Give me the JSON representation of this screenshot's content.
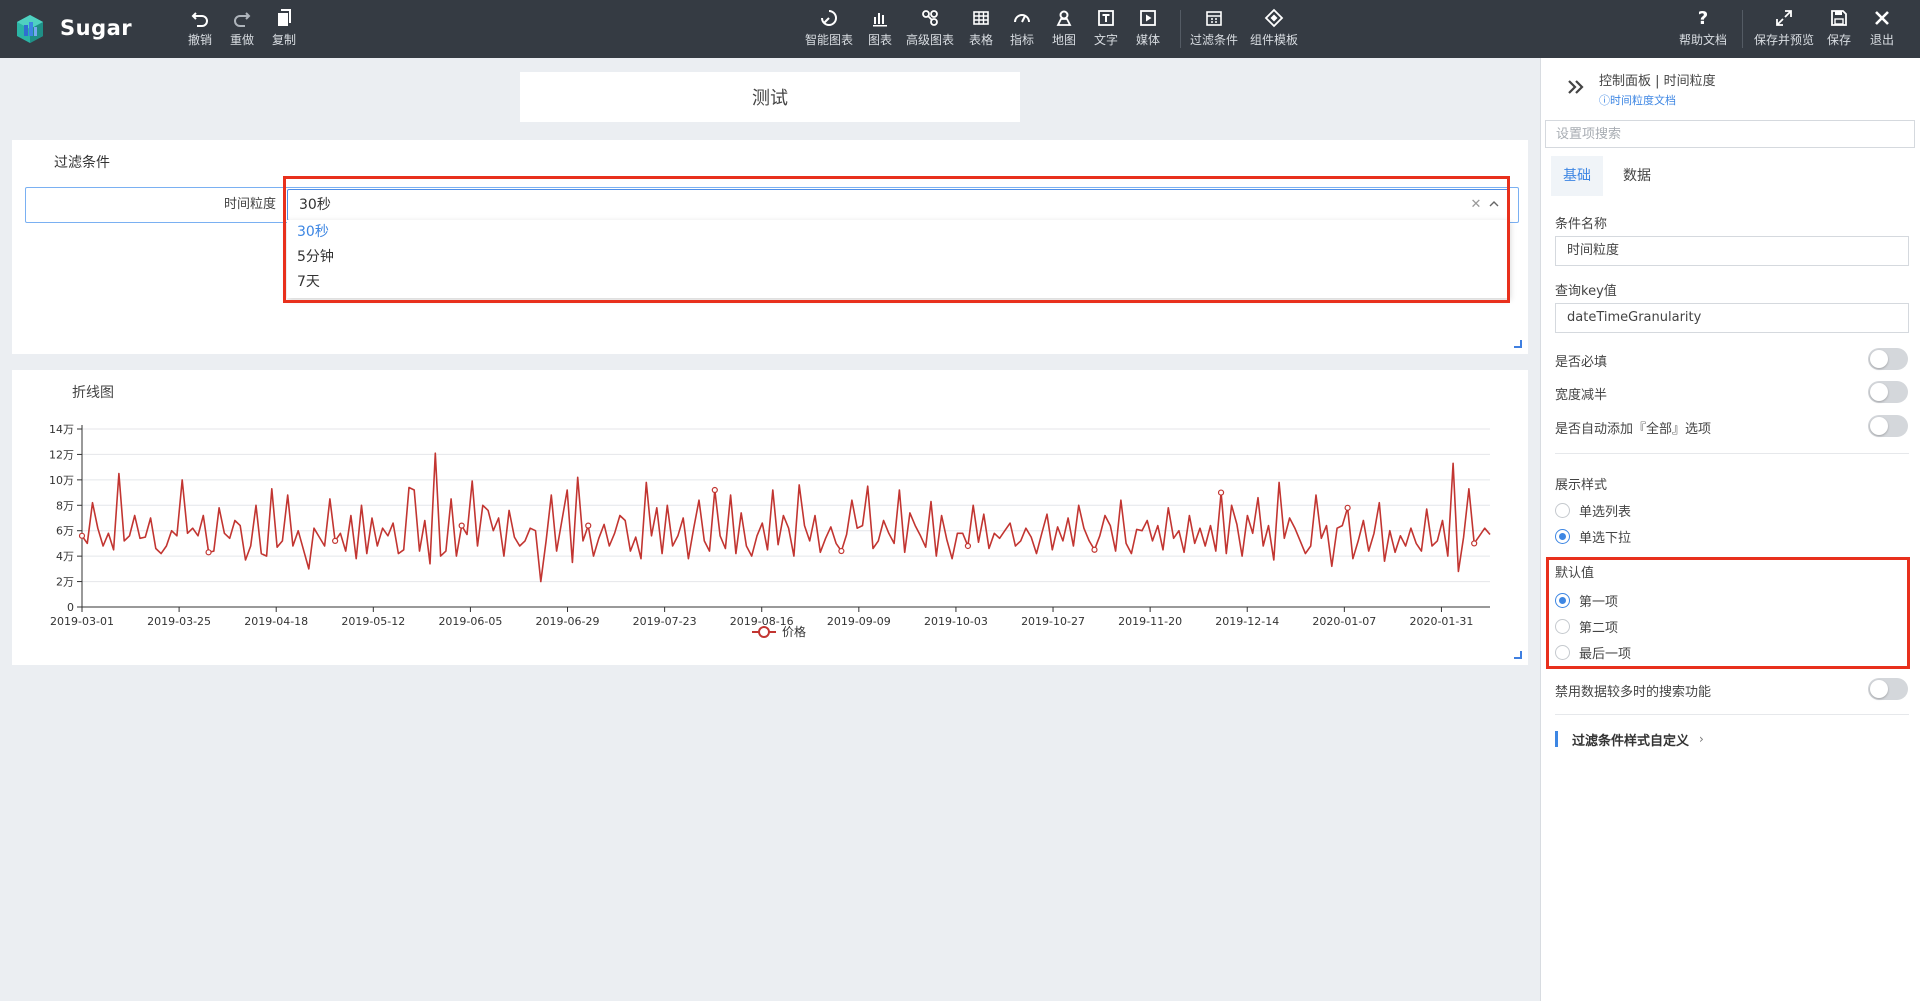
{
  "app": {
    "brand": "Sugar",
    "colors": {
      "topbar": "#353b43",
      "accent": "#3d86e3",
      "series": "#c23531",
      "highlight": "#e8301c"
    }
  },
  "toolbar": {
    "undo": "撤销",
    "redo": "重做",
    "copy": "复制",
    "smart_chart": "智能图表",
    "chart": "图表",
    "advanced_chart": "高级图表",
    "table": "表格",
    "metric": "指标",
    "map": "地图",
    "text": "文字",
    "media": "媒体",
    "filter": "过滤条件",
    "template": "组件模板",
    "help": "帮助文档",
    "save_preview": "保存并预览",
    "save": "保存",
    "exit": "退出"
  },
  "page": {
    "title": "测试"
  },
  "filter_card": {
    "title": "过滤条件",
    "label": "时间粒度",
    "selected": "30秒",
    "options": [
      "30秒",
      "5分钟",
      "7天"
    ],
    "clear_icon": "close-icon",
    "arrow_icon": "chevron-up-icon"
  },
  "chart_card": {
    "title": "折线图"
  },
  "chart_data": {
    "type": "line",
    "x_tick_labels": [
      "2019-03-01",
      "2019-03-25",
      "2019-04-18",
      "2019-05-12",
      "2019-06-05",
      "2019-06-29",
      "2019-07-23",
      "2019-08-16",
      "2019-09-09",
      "2019-10-03",
      "2019-10-27",
      "2019-11-20",
      "2019-12-14",
      "2020-01-07",
      "2020-01-31"
    ],
    "x_range": [
      "2019-03-01",
      "2020-02-12"
    ],
    "y_tick_labels": [
      "0",
      "2万",
      "4万",
      "6万",
      "8万",
      "10万",
      "12万",
      "14万"
    ],
    "ylim": [
      0,
      140000
    ],
    "grid": true,
    "legend_position": "bottom-center",
    "series": [
      {
        "name": "价格",
        "color": "#c23531",
        "values": [
          56000,
          50000,
          82000,
          62000,
          48000,
          58000,
          45000,
          105000,
          52000,
          56000,
          72000,
          54000,
          55000,
          70000,
          46000,
          42000,
          48000,
          60000,
          56000,
          100000,
          58000,
          62000,
          56000,
          72000,
          43000,
          44000,
          78000,
          58000,
          54000,
          68000,
          64000,
          37000,
          48000,
          80000,
          42000,
          40000,
          93000,
          47000,
          52000,
          88000,
          48000,
          60000,
          45000,
          30000,
          62000,
          55000,
          48000,
          85000,
          52000,
          58000,
          44000,
          72000,
          38000,
          80000,
          42000,
          70000,
          48000,
          62000,
          56000,
          66000,
          42000,
          45000,
          94000,
          92000,
          44000,
          68000,
          34000,
          121000,
          40000,
          44000,
          85000,
          40000,
          64000,
          57000,
          99000,
          48000,
          80000,
          76000,
          60000,
          70000,
          40000,
          76000,
          55000,
          48000,
          52000,
          62000,
          60000,
          20000,
          52000,
          88000,
          44000,
          68000,
          92000,
          35000,
          102000,
          52000,
          64000,
          40000,
          54000,
          65000,
          48000,
          58000,
          72000,
          68000,
          44000,
          55000,
          38000,
          98000,
          56000,
          78000,
          42000,
          80000,
          48000,
          56000,
          70000,
          38000,
          62000,
          84000,
          52000,
          44000,
          92000,
          56000,
          46000,
          88000,
          42000,
          74000,
          48000,
          40000,
          56000,
          66000,
          45000,
          92000,
          49000,
          72000,
          62000,
          40000,
          96000,
          64000,
          52000,
          72000,
          43000,
          54000,
          63000,
          50000,
          44000,
          57000,
          84000,
          62000,
          64000,
          95000,
          46000,
          52000,
          68000,
          58000,
          50000,
          92000,
          43000,
          74000,
          64000,
          56000,
          47000,
          83000,
          40000,
          72000,
          53000,
          38000,
          58000,
          58000,
          48000,
          80000,
          51000,
          73000,
          46000,
          58000,
          54000,
          60000,
          66000,
          48000,
          52000,
          62000,
          55000,
          42000,
          58000,
          73000,
          45000,
          63000,
          52000,
          70000,
          48000,
          80000,
          62000,
          52000,
          45000,
          56000,
          72000,
          64000,
          44000,
          84000,
          50000,
          42000,
          61000,
          60000,
          68000,
          52000,
          64000,
          45000,
          78000,
          54000,
          60000,
          43000,
          72000,
          50000,
          62000,
          48000,
          64000,
          44000,
          90000,
          42000,
          80000,
          65000,
          40000,
          72000,
          58000,
          86000,
          48000,
          64000,
          37000,
          98000,
          54000,
          70000,
          62000,
          52000,
          42000,
          48000,
          88000,
          54000,
          64000,
          32000,
          62000,
          64000,
          78000,
          38000,
          52000,
          68000,
          44000,
          58000,
          82000,
          36000,
          60000,
          43000,
          56000,
          48000,
          62000,
          50000,
          44000,
          77000,
          48000,
          52000,
          68000,
          40000,
          113000,
          28000,
          55000,
          93000,
          50000,
          56000,
          62000,
          57000
        ]
      }
    ]
  },
  "panel": {
    "header": "控制面板 | 时间粒度",
    "doc_link": "ⓘ时间粒度文档",
    "search_placeholder": "设置项搜索",
    "tabs": [
      "基础",
      "数据"
    ],
    "condition_name_label": "条件名称",
    "condition_name_value": "时间粒度",
    "query_key_label": "查询key值",
    "query_key_value": "dateTimeGranularity",
    "required_label": "是否必填",
    "half_width_label": "宽度减半",
    "auto_all_label": "是否自动添加『全部』选项",
    "display_style_label": "展示样式",
    "display_options": [
      "单选列表",
      "单选下拉"
    ],
    "display_selected": 1,
    "default_label": "默认值",
    "default_options": [
      "第一项",
      "第二项",
      "最后一项"
    ],
    "default_selected": 0,
    "disable_search_label": "禁用数据较多时的搜索功能",
    "custom_style_link": "过滤条件样式自定义"
  }
}
